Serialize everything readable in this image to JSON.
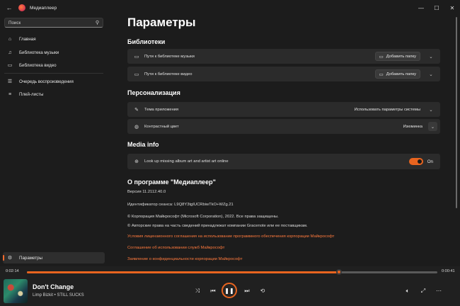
{
  "titlebar": {
    "title": "Медиаплеер",
    "back_icon": "arrow-left-icon",
    "controls": [
      "minimize-icon",
      "maximize-icon",
      "close-icon"
    ]
  },
  "sidebar": {
    "search_placeholder": "Поиск",
    "items": [
      {
        "label": "Главная",
        "icon": "home-icon"
      },
      {
        "label": "Библиотека музыки",
        "icon": "music-note-icon"
      },
      {
        "label": "Библиотека видео",
        "icon": "video-icon"
      },
      {
        "label": "Очередь воспроизведения",
        "icon": "queue-icon"
      },
      {
        "label": "Плей-листы",
        "icon": "playlist-icon"
      }
    ],
    "settings_label": "Параметры"
  },
  "main": {
    "title": "Параметры",
    "libraries": {
      "heading": "Библиотеки",
      "music_path_label": "Пути к библиотеке музыки",
      "video_path_label": "Пути к библиотеке видео",
      "add_folder_label": "Добавить папку"
    },
    "personalization": {
      "heading": "Персонализация",
      "theme_label": "Тема приложения",
      "theme_value": "Использовать параметры системы",
      "accent_label": "Контрастный цвет",
      "accent_value": "Изюминка"
    },
    "media_info": {
      "heading": "Media info",
      "lookup_label": "Look up missing album art and artist art online",
      "toggle_on": true,
      "toggle_label": "On"
    },
    "about": {
      "heading": "О программе \"Медиаплеер\"",
      "version": "Версия 11.2112.40.0",
      "session_id": "Идентификатор сеанса: L9Q8Y3tgIUCRbiwTkO+WZg.21",
      "copyright": "© Корпорация Майкрософт (Microsoft Corporation), 2022. Все права защищены.",
      "copyright_notice": "© Авторские права на часть сведений принадлежат компании Gracenote или ее поставщикам.",
      "links": [
        "Условия лицензионного соглашения на использование программного обеспечения корпорации Майкрософт",
        "Соглашение об использовании служб Майкрософт",
        "Заявление о конфиденциальности корпорации Майкрософт"
      ]
    }
  },
  "player": {
    "elapsed": "0:02:14",
    "remaining": "0:00:41",
    "progress": 0.76,
    "song_title": "Don't Change",
    "artist_album": "Limp Bizkit • STILL SUCKS",
    "accent_color": "#e8641f"
  }
}
